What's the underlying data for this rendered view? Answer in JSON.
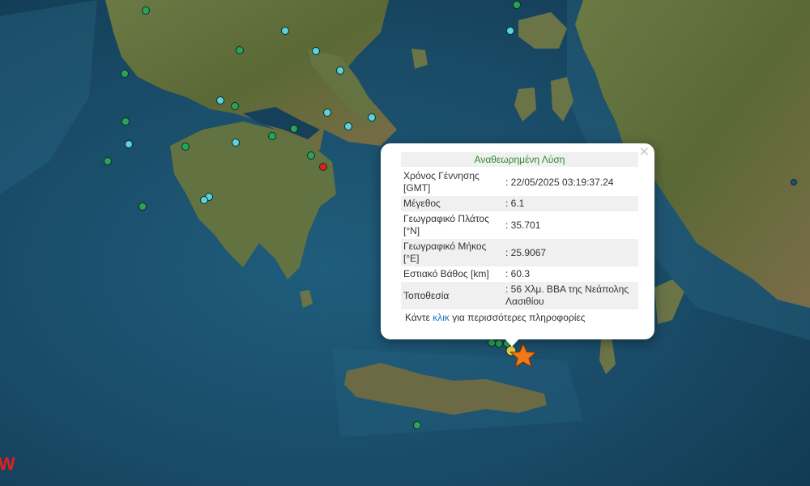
{
  "map": {
    "colors": {
      "sea": "#1a4d6a",
      "land": "#5c6b3a",
      "marker_green": "#2aa35a",
      "marker_cyan": "#5fd0e0",
      "marker_red": "#e02020",
      "epicenter": "#f07a1a"
    },
    "epicenter_icon": "star-icon"
  },
  "popup": {
    "title": "Αναθεωρημένη Λύση",
    "rows": [
      {
        "label": "Χρόνος Γέννησης [GMT]",
        "value": ": 22/05/2025 03:19:37.24"
      },
      {
        "label": "Μέγεθος",
        "value": ": 6.1"
      },
      {
        "label": "Γεωγραφικό Πλάτος [°N]",
        "value": ": 35.701"
      },
      {
        "label": "Γεωγραφικό Μήκος [°E]",
        "value": ": 25.9067"
      },
      {
        "label": "Εστιακό Βάθος [km]",
        "value": ": 60.3"
      },
      {
        "label": "Τοποθεσία",
        "value": ": 56 Χλμ. ΒΒΑ της Νεάπολης Λασιθίου"
      }
    ],
    "more_before": "Κάντε ",
    "more_link": "κλικ",
    "more_after": " για περισσότερες πληροφορίες",
    "close_label": "×"
  },
  "brand": {
    "logo_text": "W"
  }
}
